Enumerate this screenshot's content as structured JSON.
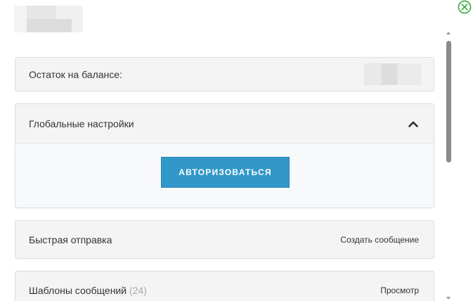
{
  "header": {
    "close_icon": "close-circle-icon",
    "accent_color": "#38a840"
  },
  "balance_panel": {
    "label": "Остаток на балансе:"
  },
  "global_settings": {
    "title": "Глобальные настройки",
    "expanded": true,
    "authorize_label": "АВТОРИЗОВАТЬСЯ",
    "button_color": "#3198c9"
  },
  "quick_send": {
    "title": "Быстрая отправка",
    "action_label": "Создать сообщение"
  },
  "templates": {
    "title": "Шаблоны сообщений",
    "count": "(24)",
    "action_label": "Просмотр"
  }
}
